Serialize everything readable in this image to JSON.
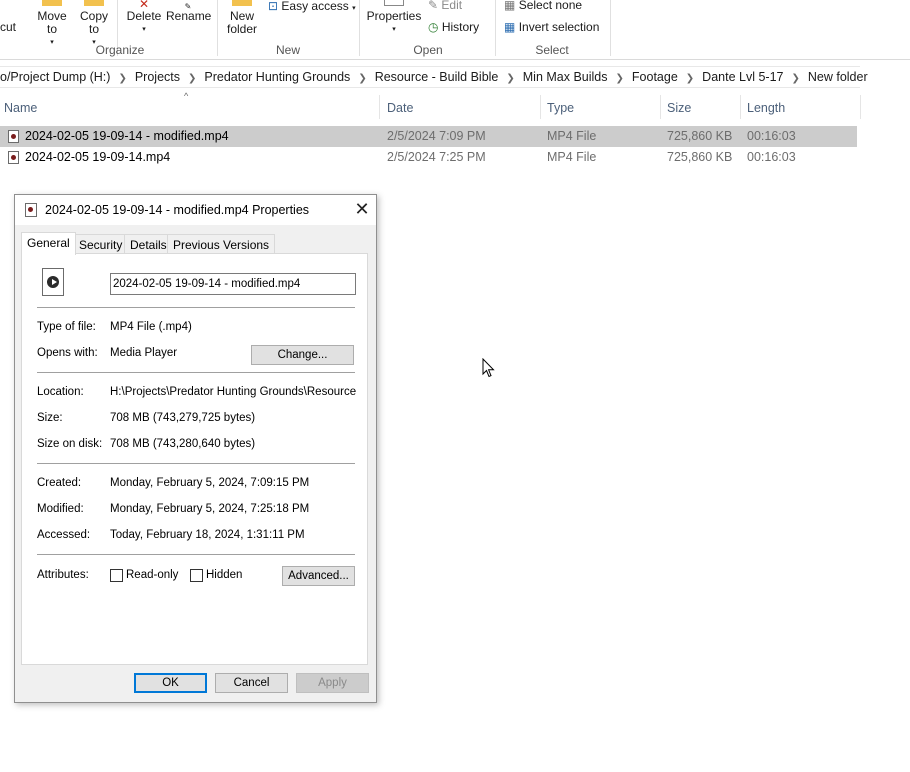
{
  "ribbon": {
    "cut_label": "cut",
    "move_to_label": "Move to",
    "copy_to_label": "Copy to",
    "delete_label": "Delete",
    "rename_label": "Rename",
    "new_folder_label": "New folder",
    "easy_access_label": "Easy access",
    "properties_label": "Properties",
    "edit_label": "Edit",
    "history_label": "History",
    "select_none_label": "Select none",
    "invert_selection_label": "Invert selection",
    "groups": {
      "organize": "Organize",
      "new": "New",
      "open": "Open",
      "select": "Select"
    }
  },
  "address": {
    "crumbs": [
      "o/Project Dump (H:)",
      "Projects",
      "Predator Hunting Grounds",
      "Resource - Build Bible",
      "Min Max Builds",
      "Footage",
      "Dante Lvl 5-17",
      "New folder"
    ]
  },
  "file_list": {
    "columns": {
      "name": "Name",
      "date": "Date",
      "type": "Type",
      "size": "Size",
      "length": "Length"
    },
    "rows": [
      {
        "name": "2024-02-05 19-09-14 - modified.mp4",
        "date": "2/5/2024 7:09 PM",
        "type": "MP4 File",
        "size": "725,860 KB",
        "length": "00:16:03",
        "selected": true
      },
      {
        "name": "2024-02-05 19-09-14.mp4",
        "date": "2/5/2024 7:25 PM",
        "type": "MP4 File",
        "size": "725,860 KB",
        "length": "00:16:03",
        "selected": false
      }
    ]
  },
  "dialog": {
    "title": "2024-02-05 19-09-14 - modified.mp4 Properties",
    "tabs": [
      "General",
      "Security",
      "Details",
      "Previous Versions"
    ],
    "filename": "2024-02-05 19-09-14 - modified.mp4",
    "type_of_file_label": "Type of file:",
    "type_of_file": "MP4 File (.mp4)",
    "opens_with_label": "Opens with:",
    "opens_with": "Media Player",
    "change_button": "Change...",
    "location_label": "Location:",
    "location": "H:\\Projects\\Predator Hunting Grounds\\Resource - E",
    "size_label": "Size:",
    "size": "708 MB (743,279,725 bytes)",
    "size_on_disk_label": "Size on disk:",
    "size_on_disk": "708 MB (743,280,640 bytes)",
    "created_label": "Created:",
    "created": "Monday, February 5, 2024, 7:09:15 PM",
    "modified_label": "Modified:",
    "modified": "Monday, February 5, 2024, 7:25:18 PM",
    "accessed_label": "Accessed:",
    "accessed": "Today, February 18, 2024, 1:31:11 PM",
    "attributes_label": "Attributes:",
    "readonly_label": "Read-only",
    "hidden_label": "Hidden",
    "advanced_button": "Advanced...",
    "ok_button": "OK",
    "cancel_button": "Cancel",
    "apply_button": "Apply"
  }
}
